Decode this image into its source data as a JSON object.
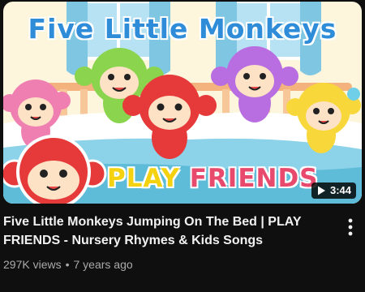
{
  "thumbnail": {
    "title_text": "Five Little Monkeys",
    "brand_text": "PLAY FRIENDS",
    "duration": "3:44"
  },
  "video": {
    "title": "Five Little Monkeys Jumping On The Bed | PLAY FRIENDS - Nursery Rhymes & Kids Songs",
    "views": "297K views",
    "separator": "•",
    "age": "7 years ago"
  },
  "icons": {
    "duration": "play-icon",
    "menu": "more-vert-icon"
  },
  "colors": {
    "background": "#0f0f0f",
    "title_text": "#f1f1f1",
    "meta_text": "#aaaaaa",
    "thumb_title": "#2f8cd8",
    "brand_play": "#f4d20f",
    "brand_friends": "#e84a6e"
  }
}
